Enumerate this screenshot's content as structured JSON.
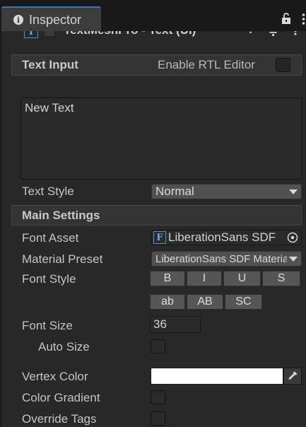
{
  "window": {
    "tab_title": "Inspector"
  },
  "component": {
    "name": "TextMeshPro - Text (UI)"
  },
  "text_input": {
    "header": "Text Input",
    "rtl_label": "Enable RTL Editor",
    "rtl_checked": false,
    "text_value": "New Text"
  },
  "text_style": {
    "label": "Text Style",
    "value": "Normal"
  },
  "main_settings": {
    "header": "Main Settings",
    "font_asset_label": "Font Asset",
    "font_asset_value": "LiberationSans SDF",
    "material_preset_label": "Material Preset",
    "material_preset_value": "LiberationSans SDF Material",
    "font_style_label": "Font Style",
    "font_style_buttons_row1": [
      "B",
      "I",
      "U",
      "S"
    ],
    "font_style_buttons_row2": [
      "ab",
      "AB",
      "SC"
    ],
    "font_size_label": "Font Size",
    "font_size_value": "36",
    "auto_size_label": "Auto Size",
    "auto_size_checked": false,
    "vertex_color_label": "Vertex Color",
    "vertex_color": "#ffffff",
    "color_gradient_label": "Color Gradient",
    "color_gradient_checked": false,
    "override_tags_label": "Override Tags",
    "override_tags_checked": false
  },
  "colors": {
    "background": "#282828",
    "section_header": "#343434",
    "accent": "#3a79bb",
    "text": "#c4c4c4"
  }
}
